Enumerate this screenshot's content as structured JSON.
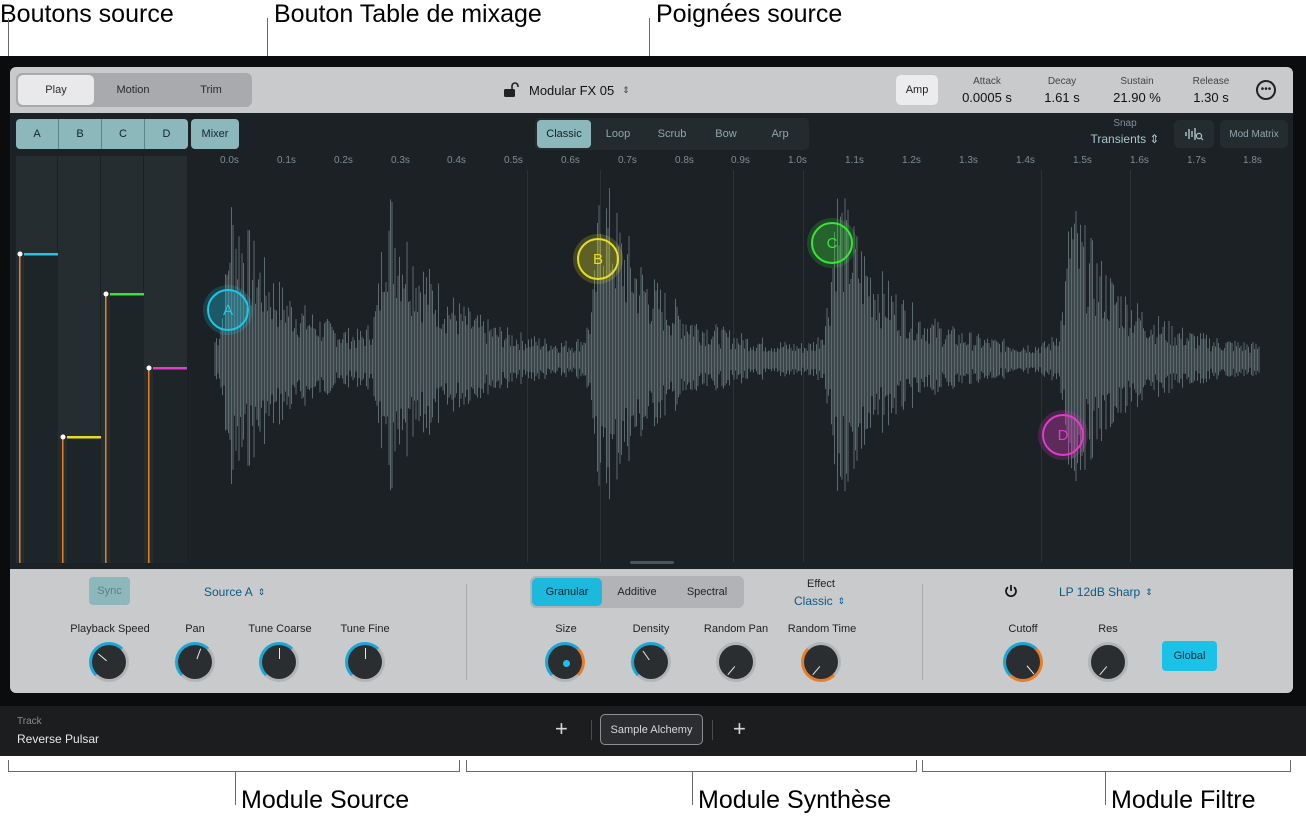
{
  "callouts": {
    "source_buttons": "Boutons source",
    "mixer_button": "Bouton Table de mixage",
    "source_handles": "Poignées source",
    "source_module": "Module Source",
    "synthesis_module": "Module Synthèse",
    "filter_module": "Module Filtre"
  },
  "header": {
    "modes": [
      "Play",
      "Motion",
      "Trim"
    ],
    "active_mode": "Play",
    "preset": "Modular FX 05",
    "preset_arrows": "⌃⌄",
    "amp_button": "Amp",
    "envelope": [
      {
        "label": "Attack",
        "value": "0.0005 s"
      },
      {
        "label": "Decay",
        "value": "1.61 s"
      },
      {
        "label": "Sustain",
        "value": "21.90 %"
      },
      {
        "label": "Release",
        "value": "1.30 s"
      }
    ],
    "more_icon": "ellipsis-circle-icon"
  },
  "sources": {
    "buttons": [
      "A",
      "B",
      "C",
      "D"
    ],
    "mixer_label": "Mixer",
    "fader_colors": [
      "#1fc7e6",
      "#e6df27",
      "#39e33b",
      "#e23cc8"
    ],
    "fader_levels": [
      0.76,
      0.31,
      0.66,
      0.48
    ]
  },
  "playmode": {
    "modes": [
      "Classic",
      "Loop",
      "Scrub",
      "Bow",
      "Arp"
    ],
    "active": "Classic",
    "snap_label": "Snap",
    "snap_value": "Transients",
    "mod_matrix": "Mod Matrix"
  },
  "timeline": [
    "0.0s",
    "0.1s",
    "0.2s",
    "0.3s",
    "0.4s",
    "0.5s",
    "0.6s",
    "0.7s",
    "0.8s",
    "0.9s",
    "1.0s",
    "1.1s",
    "1.2s",
    "1.3s",
    "1.4s",
    "1.5s",
    "1.6s",
    "1.7s",
    "1.8s"
  ],
  "handles": [
    {
      "label": "A",
      "color": "#1fc7e6"
    },
    {
      "label": "B",
      "color": "#e6df27"
    },
    {
      "label": "C",
      "color": "#39e33b"
    },
    {
      "label": "D",
      "color": "#e23cc8"
    }
  ],
  "source_module": {
    "sync": "Sync",
    "source_select": "Source A",
    "knobs": [
      "Playback Speed",
      "Pan",
      "Tune Coarse",
      "Tune Fine"
    ]
  },
  "synth_module": {
    "modes": [
      "Granular",
      "Additive",
      "Spectral"
    ],
    "active": "Granular",
    "effect_label": "Effect",
    "effect_value": "Classic",
    "knobs": [
      "Size",
      "Density",
      "Random Pan",
      "Random Time"
    ]
  },
  "filter_module": {
    "power_icon": "power-icon",
    "filter_type": "LP 12dB Sharp",
    "knobs": [
      "Cutoff",
      "Res"
    ],
    "global": "Global"
  },
  "track": {
    "label": "Track",
    "value": "Reverse Pulsar",
    "plugin": "Sample Alchemy",
    "add": "+"
  }
}
